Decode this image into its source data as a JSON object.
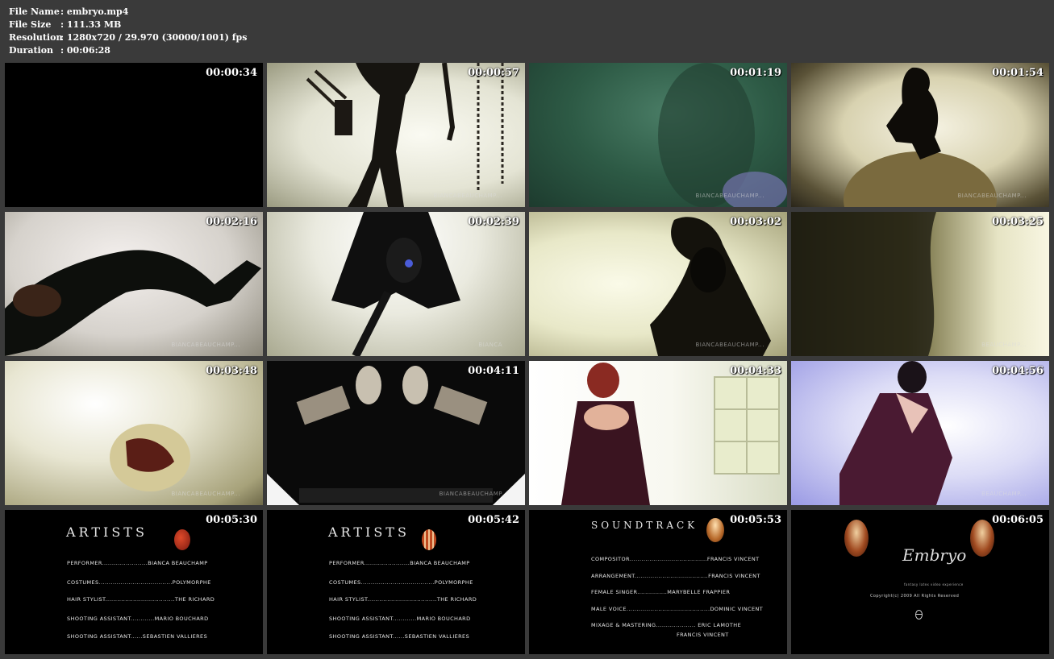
{
  "info": {
    "file_name_label": "File Name",
    "file_name": ": embryo.mp4",
    "file_size_label": "File Size",
    "file_size": ": 111.33 MB",
    "resolution_label": "Resolution",
    "resolution": ": 1280x720 / 29.970 (30000/1001) fps",
    "duration_label": "Duration",
    "duration": ": 00:06:28"
  },
  "thumbnails": [
    {
      "timestamp": "00:00:34"
    },
    {
      "timestamp": "00:00:57",
      "watermark": "BIANCABEAUCHAMP..."
    },
    {
      "timestamp": "00:01:19",
      "watermark": "BIANCABEAUCHAMP..."
    },
    {
      "timestamp": "00:01:54",
      "watermark": "BIANCABEAUCHAMP..."
    },
    {
      "timestamp": "00:02:16",
      "watermark": "BIANCABEAUCHAMP..."
    },
    {
      "timestamp": "00:02:39",
      "watermark": "BIANCA"
    },
    {
      "timestamp": "00:03:02",
      "watermark": "BIANCABEAUCHAMP..."
    },
    {
      "timestamp": "00:03:25",
      "watermark": "BEAUCHAMP..."
    },
    {
      "timestamp": "00:03:48",
      "watermark": "BIANCABEAUCHAMP..."
    },
    {
      "timestamp": "00:04:11",
      "watermark": "BIANCABEAUCHAMP"
    },
    {
      "timestamp": "00:04:33"
    },
    {
      "timestamp": "00:04:56",
      "watermark": "BEAUCHAMP..."
    },
    {
      "timestamp": "00:05:30"
    },
    {
      "timestamp": "00:05:42"
    },
    {
      "timestamp": "00:05:53"
    },
    {
      "timestamp": "00:06:05"
    }
  ],
  "credits_artists": {
    "title": "ARTISTS",
    "rows": [
      "PERFORMER.......................BIANCA BEAUCHAMP",
      "COSTUMES.....................................POLYMORPHE",
      "HAIR STYLIST...................................THE RICHARD",
      "SHOOTING ASSISTANT............MARIO BOUCHARD",
      "SHOOTING ASSISTANT......SEBASTIEN VALLIERES"
    ]
  },
  "credits_soundtrack": {
    "title": "SOUNDTRACK",
    "rows": [
      "COMPOSITOR.......................................FRANCIS VINCENT",
      "ARRANGEMENT.....................................FRANCIS VINCENT",
      "FEMALE SINGER...............MARYBELLE FRAPPIER",
      "MALE VOICE..........................................DOMINIC VINCENT",
      "MIXAGE & MASTERING.................... ERIC LAMOTHE",
      "FRANCIS VINCENT"
    ]
  },
  "credits_end": {
    "logo": "Embryo",
    "tagline": "fantasy latex video experience",
    "copyright": "Copyright(c) 2009 All Rights Reserved"
  }
}
